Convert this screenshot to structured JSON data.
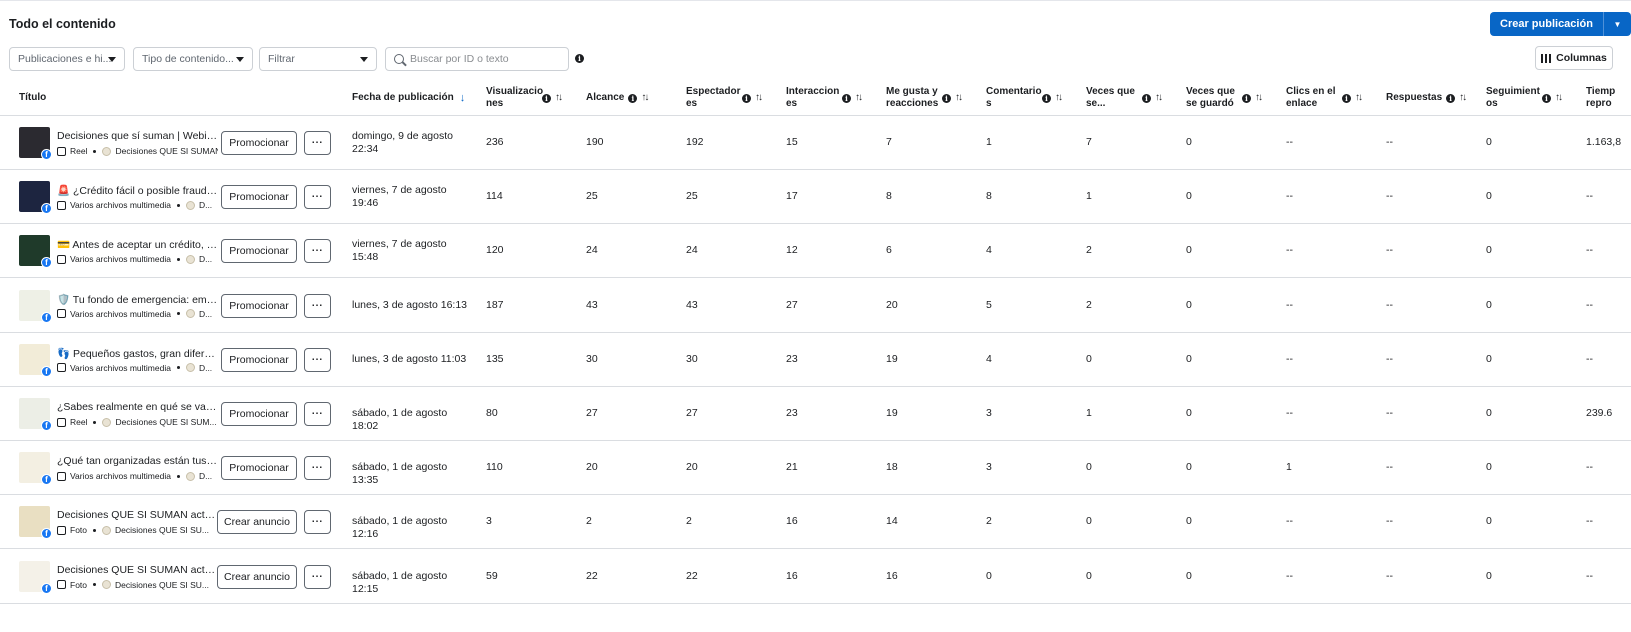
{
  "header": {
    "title": "Todo el contenido",
    "create_label": "Crear publicación",
    "columns_label": "Columnas"
  },
  "filters": {
    "publications": "Publicaciones e hi...",
    "content_type": "Tipo de contenido...",
    "filter": "Filtrar",
    "search_placeholder": "Buscar por ID o texto"
  },
  "columns": {
    "title": "Título",
    "date": "Fecha de publicación",
    "views": "Visualizacio nes",
    "reach": "Alcance",
    "viewers": "Espectador es",
    "interactions": "Interaccion es",
    "likes": "Me gusta y reacciones",
    "comments": "Comentario s",
    "shares": "Veces que se...",
    "saves": "Veces que se guardó",
    "link_clicks": "Clics en el enlace",
    "replies": "Respuestas",
    "follows": "Seguimient os",
    "watch_time": "Tiemp repro"
  },
  "rows": [
    {
      "title": "Decisiones que sí suman | Webinar de finanzas",
      "type": "Reel",
      "author": "Decisiones QUE SI SUMAN",
      "action": "Promocionar",
      "date": "domingo, 9 de agosto 22:34",
      "views": "236",
      "reach": "190",
      "viewers": "192",
      "interactions": "15",
      "likes": "7",
      "comments": "1",
      "shares": "7",
      "saves": "0",
      "clicks": "--",
      "replies": "--",
      "follows": "0",
      "watch": "1.163,8",
      "thumb": "#2b2a30"
    },
    {
      "title": "🚨 ¿Crédito fácil o posible fraude? En...",
      "type": "Varios archivos multimedia",
      "author": "D...",
      "action": "Promocionar",
      "date": "viernes, 7 de agosto 19:46",
      "views": "114",
      "reach": "25",
      "viewers": "25",
      "interactions": "17",
      "likes": "8",
      "comments": "8",
      "shares": "1",
      "saves": "0",
      "clicks": "--",
      "replies": "--",
      "follows": "0",
      "watch": "--",
      "thumb": "#1d2540"
    },
    {
      "title": "💳 Antes de aceptar un crédito, mira...",
      "type": "Varios archivos multimedia",
      "author": "D...",
      "action": "Promocionar",
      "date": "viernes, 7 de agosto 15:48",
      "views": "120",
      "reach": "24",
      "viewers": "24",
      "interactions": "12",
      "likes": "6",
      "comments": "4",
      "shares": "2",
      "saves": "0",
      "clicks": "--",
      "replies": "--",
      "follows": "0",
      "watch": "--",
      "thumb": "#1f3a2a"
    },
    {
      "title": "🛡️ Tu fondo de emergencia: empieza...",
      "type": "Varios archivos multimedia",
      "author": "D...",
      "action": "Promocionar",
      "date": "lunes, 3 de agosto 16:13",
      "views": "187",
      "reach": "43",
      "viewers": "43",
      "interactions": "27",
      "likes": "20",
      "comments": "5",
      "shares": "2",
      "saves": "0",
      "clicks": "--",
      "replies": "--",
      "follows": "0",
      "watch": "--",
      "thumb": "#eef0e6"
    },
    {
      "title": "👣 Pequeños gastos, gran diferencia...",
      "type": "Varios archivos multimedia",
      "author": "D...",
      "action": "Promocionar",
      "date": "lunes, 3 de agosto 11:03",
      "views": "135",
      "reach": "30",
      "viewers": "30",
      "interactions": "23",
      "likes": "19",
      "comments": "4",
      "shares": "0",
      "saves": "0",
      "clicks": "--",
      "replies": "--",
      "follows": "0",
      "watch": "--",
      "thumb": "#f2ecd8"
    },
    {
      "title": "¿Sabes realmente en qué se va tu di...",
      "type": "Reel",
      "author": "Decisiones QUE SI SUM...",
      "action": "Promocionar",
      "date": "sábado, 1 de agosto 18:02",
      "views": "80",
      "reach": "27",
      "viewers": "27",
      "interactions": "23",
      "likes": "19",
      "comments": "3",
      "shares": "1",
      "saves": "0",
      "clicks": "--",
      "replies": "--",
      "follows": "0",
      "watch": "239.6",
      "thumb": "#eceee6"
    },
    {
      "title": "¿Qué tan organizadas están tus finan...",
      "type": "Varios archivos multimedia",
      "author": "D...",
      "action": "Promocionar",
      "date": "sábado, 1 de agosto 13:35",
      "views": "110",
      "reach": "20",
      "viewers": "20",
      "interactions": "21",
      "likes": "18",
      "comments": "3",
      "shares": "0",
      "saves": "0",
      "clicks": "1",
      "replies": "--",
      "follows": "0",
      "watch": "--",
      "thumb": "#f3efe2"
    },
    {
      "title": "Decisiones QUE SI SUMAN actualiz...",
      "type": "Foto",
      "author": "Decisiones QUE SI SU...",
      "action": "Crear anuncio",
      "date": "sábado, 1 de agosto 12:16",
      "views": "3",
      "reach": "2",
      "viewers": "2",
      "interactions": "16",
      "likes": "14",
      "comments": "2",
      "shares": "0",
      "saves": "0",
      "clicks": "--",
      "replies": "--",
      "follows": "0",
      "watch": "--",
      "thumb": "#e9dfc2"
    },
    {
      "title": "Decisiones QUE SI SUMAN actualiz...",
      "type": "Foto",
      "author": "Decisiones QUE SI SU...",
      "action": "Crear anuncio",
      "date": "sábado, 1 de agosto 12:15",
      "views": "59",
      "reach": "22",
      "viewers": "22",
      "interactions": "16",
      "likes": "16",
      "comments": "0",
      "shares": "0",
      "saves": "0",
      "clicks": "--",
      "replies": "--",
      "follows": "0",
      "watch": "--",
      "thumb": "#f4f1e8"
    }
  ]
}
